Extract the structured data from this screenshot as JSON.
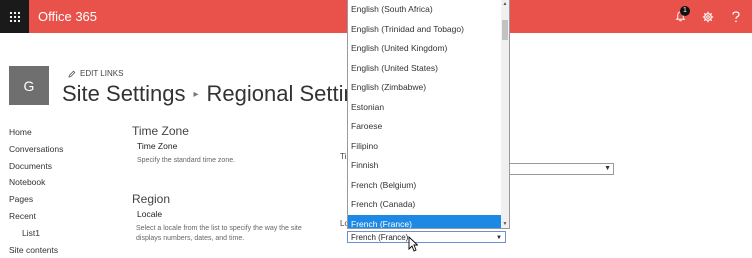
{
  "suitebar": {
    "brand": "Office 365",
    "notifications_count": "1"
  },
  "site": {
    "logo_letter": "G",
    "edit_links": "EDIT LINKS",
    "breadcrumb": [
      "Site Settings",
      "Regional Settings"
    ]
  },
  "quick_launch": [
    {
      "label": "Home"
    },
    {
      "label": "Conversations"
    },
    {
      "label": "Documents"
    },
    {
      "label": "Notebook"
    },
    {
      "label": "Pages"
    },
    {
      "label": "Recent"
    },
    {
      "label": "List1",
      "sub": true
    },
    {
      "label": "Site contents"
    }
  ],
  "timezone": {
    "section_title": "Time Zone",
    "field_title": "Time Zone",
    "description": "Specify the standard time zone.",
    "cut_label": "Ti"
  },
  "region": {
    "section_title": "Region",
    "field_title": "Locale",
    "description_line1": "Select a locale from the list to specify the way the site",
    "description_line2": "displays numbers, dates, and time.",
    "cut_label": "Lo"
  },
  "locale_dropdown": {
    "options": [
      "English (South Africa)",
      "English (Trinidad and Tobago)",
      "English (United Kingdom)",
      "English (United States)",
      "English (Zimbabwe)",
      "Estonian",
      "Faroese",
      "Filipino",
      "Finnish",
      "French (Belgium)",
      "French (Canada)",
      "French (France)"
    ],
    "selected": "French (France)"
  },
  "colors": {
    "suitebar": "#e8524a",
    "waffle": "#1a1a1a",
    "selection": "#1e88e5"
  }
}
